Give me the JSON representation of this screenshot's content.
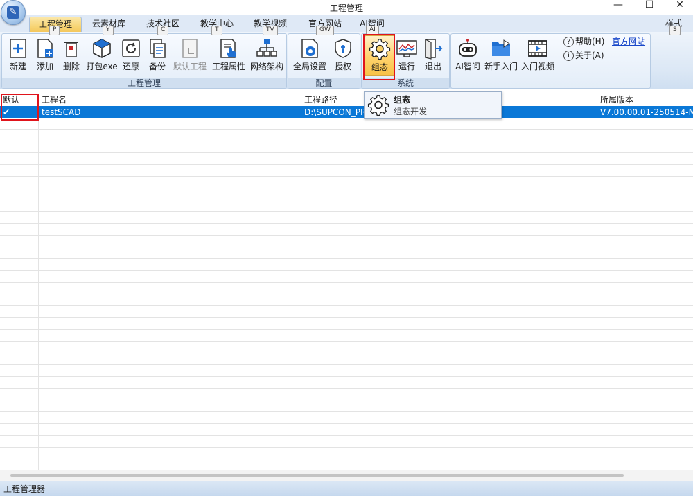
{
  "window": {
    "title": "工程管理",
    "minimize_glyph": "—",
    "maximize_glyph": "☐",
    "close_glyph": "✕"
  },
  "tabs": [
    {
      "label": "工程管理",
      "keytip": "P"
    },
    {
      "label": "云素材库",
      "keytip": "Y"
    },
    {
      "label": "技术社区",
      "keytip": "C"
    },
    {
      "label": "教学中心",
      "keytip": "T"
    },
    {
      "label": "教学视频",
      "keytip": "TV"
    },
    {
      "label": "官方网站",
      "keytip": "GW"
    },
    {
      "label": "AI智问",
      "keytip": "AI"
    }
  ],
  "style_menu": {
    "label": "样式",
    "keytip": "S"
  },
  "ribbon": {
    "project_group": {
      "label": "工程管理",
      "buttons": [
        "新建",
        "添加",
        "删除",
        "打包exe",
        "还原",
        "备份",
        "默认工程",
        "工程属性",
        "网络架构"
      ]
    },
    "config_group": {
      "label": "配置",
      "buttons": [
        "全局设置",
        "授权"
      ]
    },
    "system_group": {
      "label": "系统",
      "buttons": [
        "组态",
        "运行",
        "退出"
      ]
    },
    "help_group": {
      "buttons": [
        "AI智问",
        "新手入门",
        "入门视频"
      ],
      "help_label": "帮助(H)",
      "about_label": "关于(A)",
      "website_link": "官方网站"
    }
  },
  "tooltip": {
    "title": "组态",
    "description": "组态开发"
  },
  "grid": {
    "headers": [
      "默认",
      "工程名",
      "工程路径",
      "所属版本"
    ],
    "rows": [
      {
        "default": "✔",
        "name": "testSCAD",
        "path": "D:\\SUPCON_PR",
        "version": "V7.00.00.01-250514-M"
      }
    ]
  },
  "status": {
    "text": "工程管理器"
  },
  "colors": {
    "selection": "#0a78d7",
    "highlight_box": "#e0141c",
    "active_tab": "#f7d575"
  }
}
